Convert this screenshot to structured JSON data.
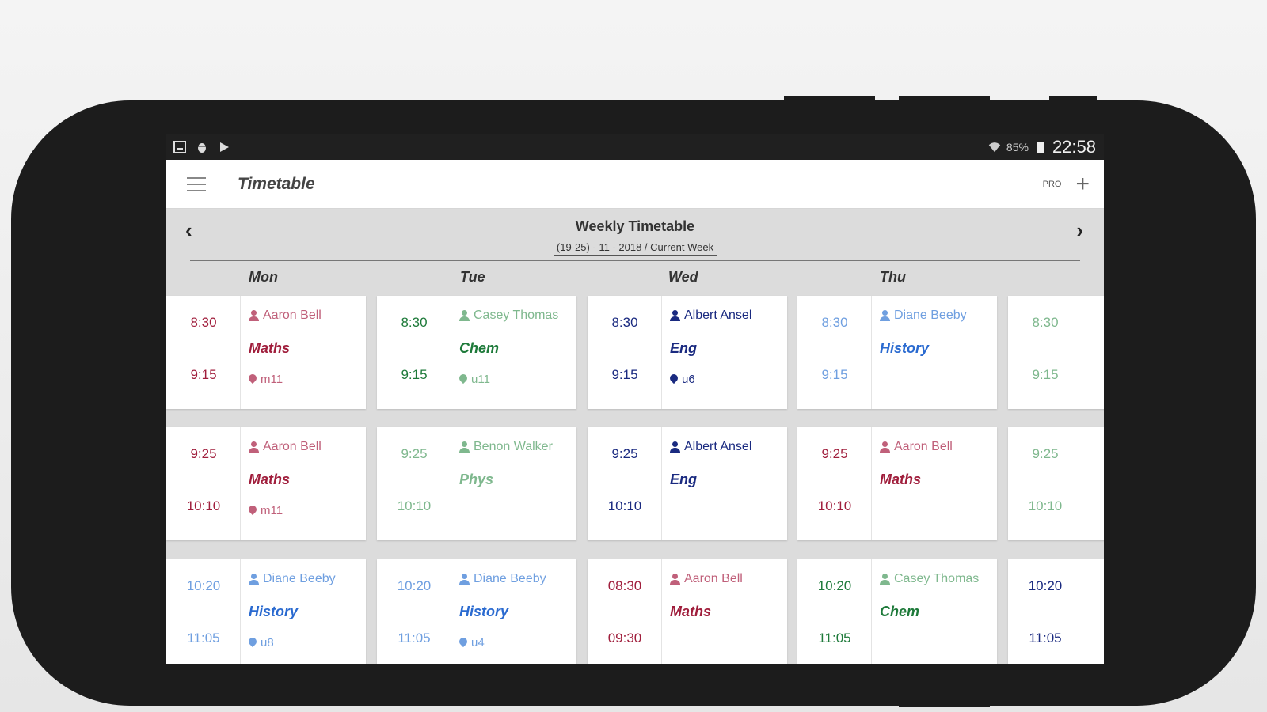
{
  "status": {
    "battery": "85%",
    "time": "22:58",
    "icons": [
      "gallery-icon",
      "bug-icon",
      "play-store-icon"
    ]
  },
  "appbar": {
    "title": "Timetable",
    "pro_label": "PRO",
    "add": "+"
  },
  "week": {
    "title": "Weekly Timetable",
    "range": "(19-25) - 11 - 2018 / Current Week",
    "prev": "‹",
    "next": "›"
  },
  "days": [
    "Mon",
    "Tue",
    "Wed",
    "Thu"
  ],
  "rows": [
    [
      {
        "start": "8:30",
        "end": "9:15",
        "teacher": "Aaron Bell",
        "subject": "Maths",
        "room": "m11",
        "color": "red"
      },
      {
        "start": "8:30",
        "end": "9:15",
        "teacher": "Casey Thomas",
        "subject": "Chem",
        "room": "u11",
        "color": "green"
      },
      {
        "start": "8:30",
        "end": "9:15",
        "teacher": "Albert Ansel",
        "subject": "Eng",
        "room": "u6",
        "color": "navy"
      },
      {
        "start": "8:30",
        "end": "9:15",
        "teacher": "Diane Beeby",
        "subject": "History",
        "room": "",
        "color": "blue"
      },
      {
        "start": "8:30",
        "end": "9:15",
        "teacher": "",
        "subject": "",
        "room": "",
        "color": "ltgreen"
      }
    ],
    [
      {
        "start": "9:25",
        "end": "10:10",
        "teacher": "Aaron Bell",
        "subject": "Maths",
        "room": "m11",
        "color": "red"
      },
      {
        "start": "9:25",
        "end": "10:10",
        "teacher": "Benon Walker",
        "subject": "Phys",
        "room": "",
        "color": "ltgreen"
      },
      {
        "start": "9:25",
        "end": "10:10",
        "teacher": "Albert Ansel",
        "subject": "Eng",
        "room": "",
        "color": "navy"
      },
      {
        "start": "9:25",
        "end": "10:10",
        "teacher": "Aaron Bell",
        "subject": "Maths",
        "room": "",
        "color": "red"
      },
      {
        "start": "9:25",
        "end": "10:10",
        "teacher": "",
        "subject": "",
        "room": "",
        "color": "ltgreen"
      }
    ],
    [
      {
        "start": "10:20",
        "end": "11:05",
        "teacher": "Diane Beeby",
        "subject": "History",
        "room": "u8",
        "color": "blue"
      },
      {
        "start": "10:20",
        "end": "11:05",
        "teacher": "Diane Beeby",
        "subject": "History",
        "room": "u4",
        "color": "blue"
      },
      {
        "start": "08:30",
        "end": "09:30",
        "teacher": "Aaron Bell",
        "subject": "Maths",
        "room": "",
        "color": "red"
      },
      {
        "start": "10:20",
        "end": "11:05",
        "teacher": "Casey Thomas",
        "subject": "Chem",
        "room": "",
        "color": "green"
      },
      {
        "start": "10:20",
        "end": "11:05",
        "teacher": "",
        "subject": "",
        "room": "",
        "color": "navy"
      }
    ]
  ]
}
